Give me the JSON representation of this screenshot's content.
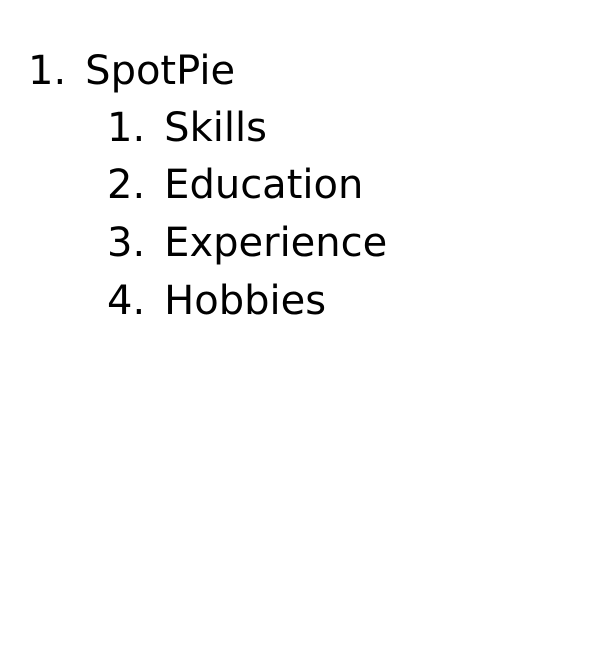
{
  "outline": {
    "items": [
      {
        "number": "1.",
        "label": "SpotPie",
        "children": [
          {
            "number": "1.",
            "label": "Skills"
          },
          {
            "number": "2.",
            "label": "Education"
          },
          {
            "number": "3.",
            "label": "Experience"
          },
          {
            "number": "4.",
            "label": "Hobbies"
          }
        ]
      }
    ]
  }
}
